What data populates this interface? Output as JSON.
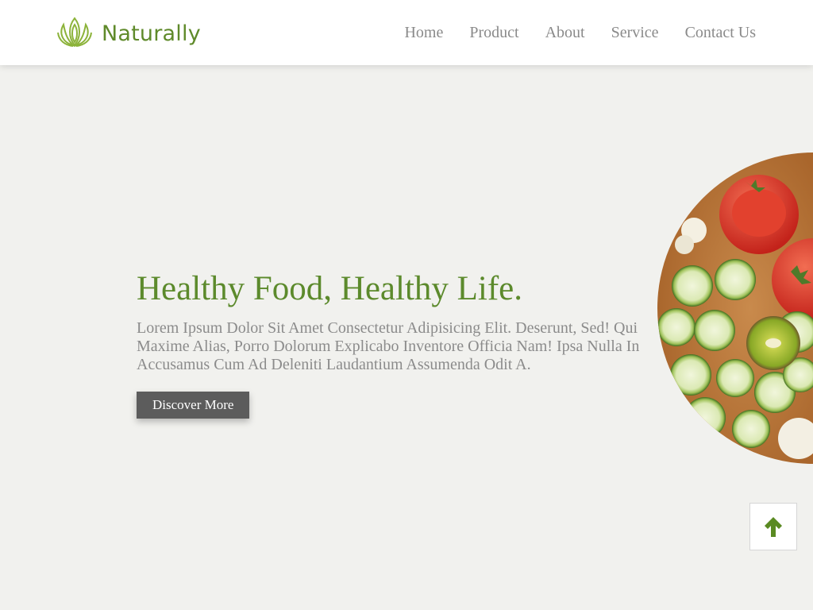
{
  "brand": {
    "name": "Naturally",
    "icon": "lotus-leaf-icon",
    "color": "#5f8a2a"
  },
  "nav": [
    {
      "label": "Home"
    },
    {
      "label": "Product"
    },
    {
      "label": "About"
    },
    {
      "label": "Service"
    },
    {
      "label": "Contact Us"
    }
  ],
  "hero": {
    "title": "Healthy Food, Healthy Life.",
    "description": "Lorem Ipsum Dolor Sit Amet Consectetur Adipisicing Elit. Deserunt, Sed! Qui Maxime Alias, Porro Dolorum Explicabo Inventore Officia Nam! Ipsa Nulla In Accusamus Cum Ad Deleniti Laudantium Assumenda Odit A.",
    "button_label": "Discover More",
    "image": "vegetable-plate-image"
  },
  "scroll_top": {
    "icon": "arrow-up-icon"
  },
  "colors": {
    "accent": "#5c8a2c",
    "background": "#f1f1ee",
    "button": "#5c5c5c"
  }
}
